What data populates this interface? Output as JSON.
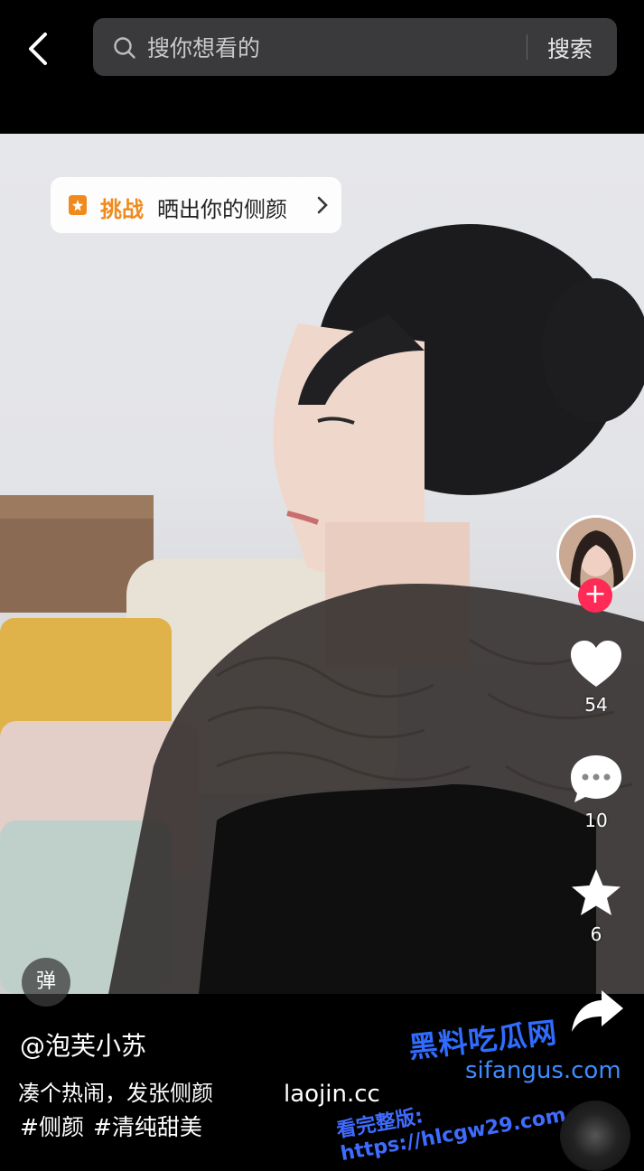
{
  "search": {
    "placeholder": "搜你想看的",
    "button_label": "搜索"
  },
  "challenge": {
    "badge": "挑战",
    "title": "晒出你的侧颜"
  },
  "danmu_label": "弹",
  "actions": {
    "likes": "54",
    "comments": "10",
    "favorites": "6"
  },
  "post": {
    "author": "@泡芙小苏",
    "caption": "凑个热闹，发张侧颜",
    "hashtags": [
      "#侧颜",
      "#清纯甜美"
    ]
  },
  "watermarks": {
    "site_a": "laojin.cc",
    "brand": "黑料吃瓜网",
    "url": "sifangus.com",
    "promo": "看完整版: https://hlcgw29.com"
  },
  "colors": {
    "accent_orange": "#f08a1c",
    "follow_red": "#ff2a55",
    "search_bg": "#3a3a3c"
  }
}
